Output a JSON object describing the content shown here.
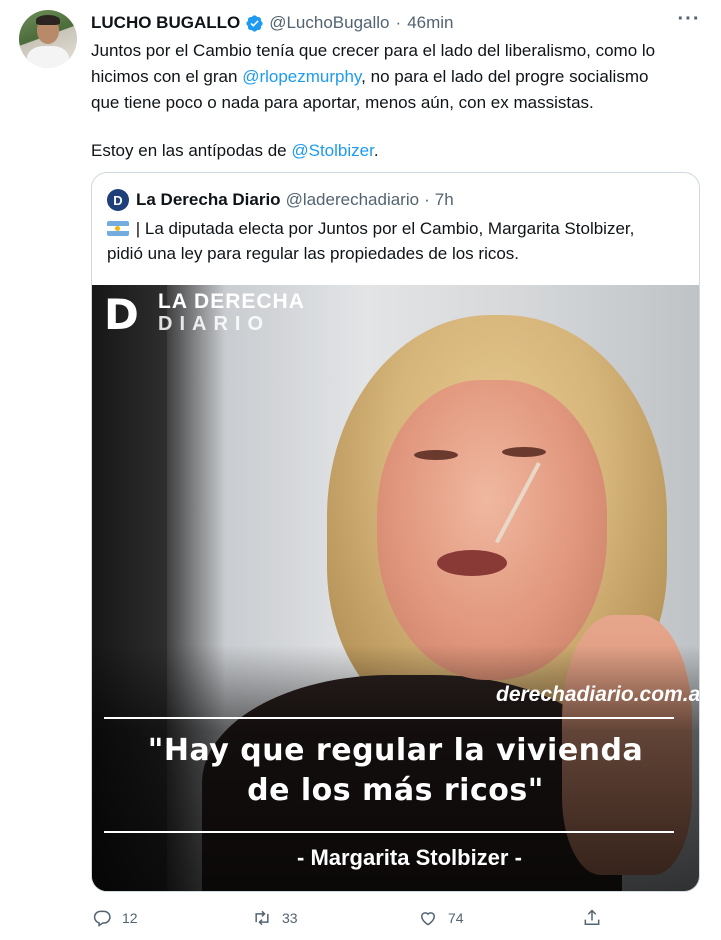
{
  "author": {
    "name": "LUCHO BUGALLO",
    "handle": "@LuchoBugallo",
    "separator": "·",
    "time": "46min"
  },
  "tweet": {
    "line1": "Juntos por el Cambio tenía que crecer para el lado del liberalismo, como lo",
    "line2_prefix": "hicimos con el gran ",
    "mention1": "@rlopezmurphy",
    "line2_suffix": ", no para el lado del progre socialismo",
    "line3": "que tiene poco o nada para aportar, menos aún, con ex massistas.",
    "line4_prefix": "Estoy en las antípodas de ",
    "mention2": "@Stolbizer",
    "line4_suffix": "."
  },
  "quote": {
    "name": "La Derecha Diario",
    "handle": "@laderechadiario",
    "separator": "·",
    "time": "7h",
    "avatar_letter": "D",
    "text_line1": " | La diputada electa por Juntos por el Cambio, Margarita Stolbizer,",
    "text_line2": "pidió una ley para regular las propiedades de los ricos."
  },
  "media": {
    "brand_line1": "LA DERECHA",
    "brand_line2": "DIARIO",
    "site": "derechadiario.com.ar",
    "headline_line1": "\"Hay que regular la vivienda",
    "headline_line2": "de los más ricos\"",
    "caption": "- Margarita Stolbizer -"
  },
  "actions": {
    "replies": "12",
    "retweets": "33",
    "likes": "74"
  },
  "colors": {
    "link": "#1d9bf0",
    "muted": "#536471",
    "verified": "#1d9bf0"
  }
}
